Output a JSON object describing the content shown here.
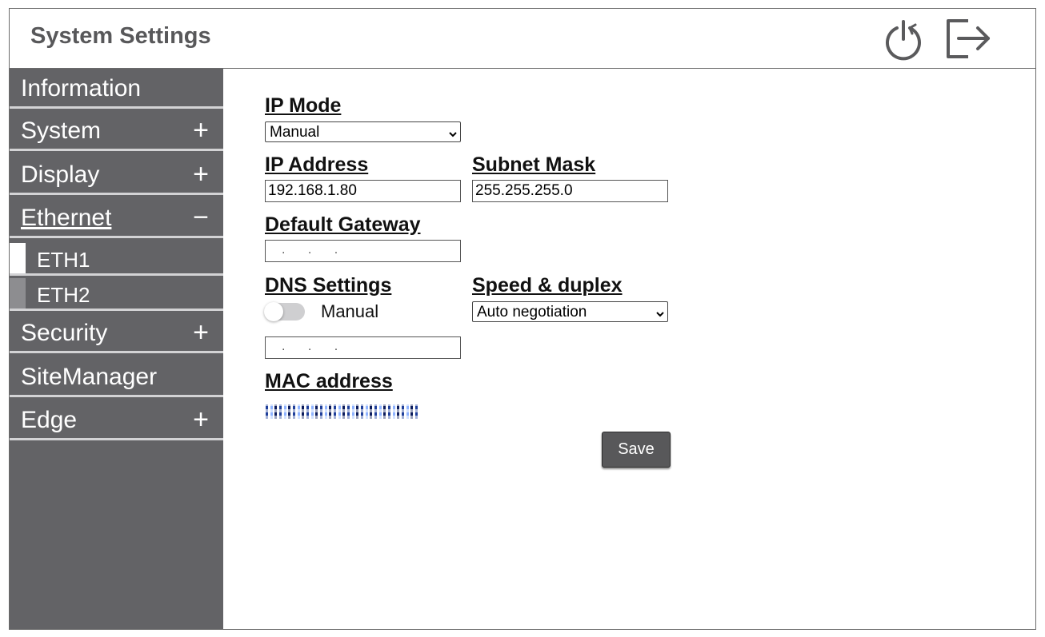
{
  "header": {
    "title": "System Settings",
    "power_icon": "power-icon",
    "logout_icon": "logout-icon"
  },
  "sidebar": {
    "items": [
      {
        "label": "Information",
        "toggle": ""
      },
      {
        "label": "System",
        "toggle": "+"
      },
      {
        "label": "Display",
        "toggle": "+"
      },
      {
        "label": "Ethernet",
        "toggle": "−",
        "active": true
      },
      {
        "label": "Security",
        "toggle": "+"
      },
      {
        "label": "SiteManager",
        "toggle": ""
      },
      {
        "label": "Edge",
        "toggle": "+"
      }
    ],
    "sub_items": [
      {
        "label": "ETH1",
        "selected": true
      },
      {
        "label": "ETH2",
        "selected": false
      }
    ]
  },
  "form": {
    "ip_mode": {
      "label": "IP Mode",
      "value": "Manual"
    },
    "ip_address": {
      "label": "IP Address",
      "value": "192.168.1.80"
    },
    "subnet_mask": {
      "label": "Subnet Mask",
      "value": "255.255.255.0"
    },
    "default_gateway": {
      "label": "Default Gateway",
      "placeholder": ". . ."
    },
    "dns": {
      "label": "DNS Settings",
      "toggle_label": "Manual",
      "toggle_on": false,
      "placeholder": ". . ."
    },
    "speed_duplex": {
      "label": "Speed & duplex",
      "value": "Auto negotiation"
    },
    "mac": {
      "label": "MAC address"
    },
    "save_label": "Save"
  },
  "colors": {
    "sidebar_bg": "#636366",
    "save_bg": "#58585a",
    "title_color": "#58585a"
  }
}
